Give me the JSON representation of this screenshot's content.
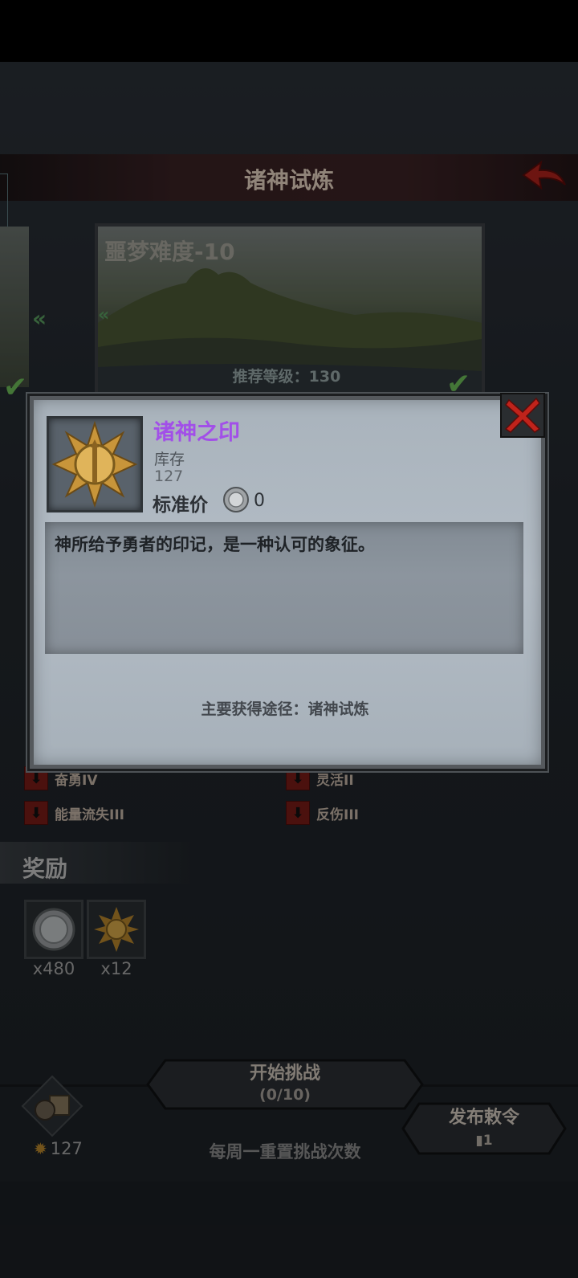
{
  "header": {
    "title": "诸神试炼"
  },
  "stage": {
    "title": "噩梦难度-10",
    "recommended_level": "推荐等级：130"
  },
  "debuffs": [
    {
      "label": "奋勇IV"
    },
    {
      "label": "灵活II"
    },
    {
      "label": "能量流失III"
    },
    {
      "label": "反伤III"
    }
  ],
  "rewards": {
    "label": "奖励",
    "items": [
      {
        "icon": "silver-coin-icon",
        "count": "x480"
      },
      {
        "icon": "gods-seal-icon",
        "count": "x12"
      }
    ]
  },
  "actions": {
    "start_label": "开始挑战",
    "start_count": "(0/10)",
    "publish_label": "发布敕令",
    "publish_count": "1",
    "weekly_reset": "每周一重置挑战次数",
    "currency_amount": "127"
  },
  "popup": {
    "item_name": "诸神之印",
    "stock_label": "库存",
    "stock_value": "127",
    "price_label": "标准价",
    "price_value": "0",
    "description": "神所给予勇者的印记，是一种认可的象征。",
    "source": "主要获得途径：诸神试炼"
  },
  "colors": {
    "item_name": "#a24fe8",
    "close": "#c0231b",
    "header_band": "#3d2326"
  }
}
